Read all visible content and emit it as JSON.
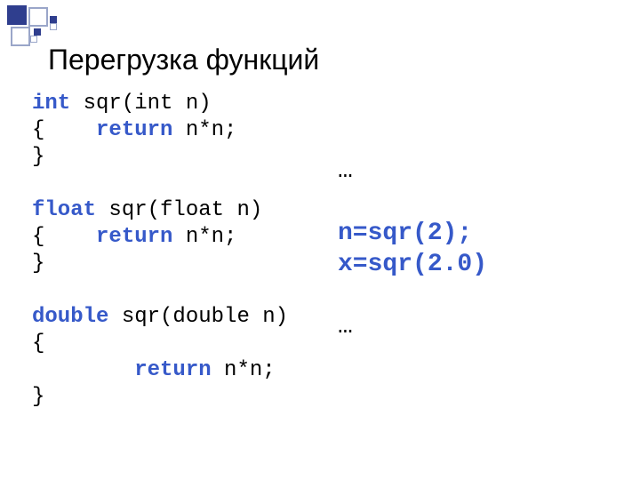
{
  "title": "Перегрузка функций",
  "left": {
    "lines": [
      [
        {
          "t": "int",
          "c": "kw"
        },
        {
          "t": " sqr(int n)",
          "c": "blk"
        }
      ],
      [
        {
          "t": "{    ",
          "c": "blk"
        },
        {
          "t": "return",
          "c": "kw"
        },
        {
          "t": " n*n;",
          "c": "blk"
        }
      ],
      [
        {
          "t": "}",
          "c": "blk"
        }
      ],
      [
        {
          "t": "",
          "c": "blk"
        }
      ],
      [
        {
          "t": "float",
          "c": "kw"
        },
        {
          "t": " sqr(float n)",
          "c": "blk"
        }
      ],
      [
        {
          "t": "{    ",
          "c": "blk"
        },
        {
          "t": "return",
          "c": "kw"
        },
        {
          "t": " n*n;",
          "c": "blk"
        }
      ],
      [
        {
          "t": "}",
          "c": "blk"
        }
      ],
      [
        {
          "t": "",
          "c": "blk"
        }
      ],
      [
        {
          "t": "double",
          "c": "kw"
        },
        {
          "t": " sqr(double n)",
          "c": "blk"
        }
      ],
      [
        {
          "t": "{",
          "c": "blk"
        }
      ],
      [
        {
          "t": "        ",
          "c": "blk"
        },
        {
          "t": "return",
          "c": "kw"
        },
        {
          "t": " n*n;",
          "c": "blk"
        }
      ],
      [
        {
          "t": "}",
          "c": "blk"
        }
      ]
    ]
  },
  "right": {
    "lines": [
      [
        {
          "t": "…",
          "c": "blk"
        }
      ],
      [
        {
          "t": "",
          "c": "blk"
        }
      ],
      [
        {
          "t": "n=sqr(2);",
          "c": "call"
        }
      ],
      [
        {
          "t": "x=sqr(2.0)",
          "c": "call"
        }
      ],
      [
        {
          "t": "",
          "c": "blk"
        }
      ],
      [
        {
          "t": "…",
          "c": "blk"
        }
      ]
    ]
  }
}
